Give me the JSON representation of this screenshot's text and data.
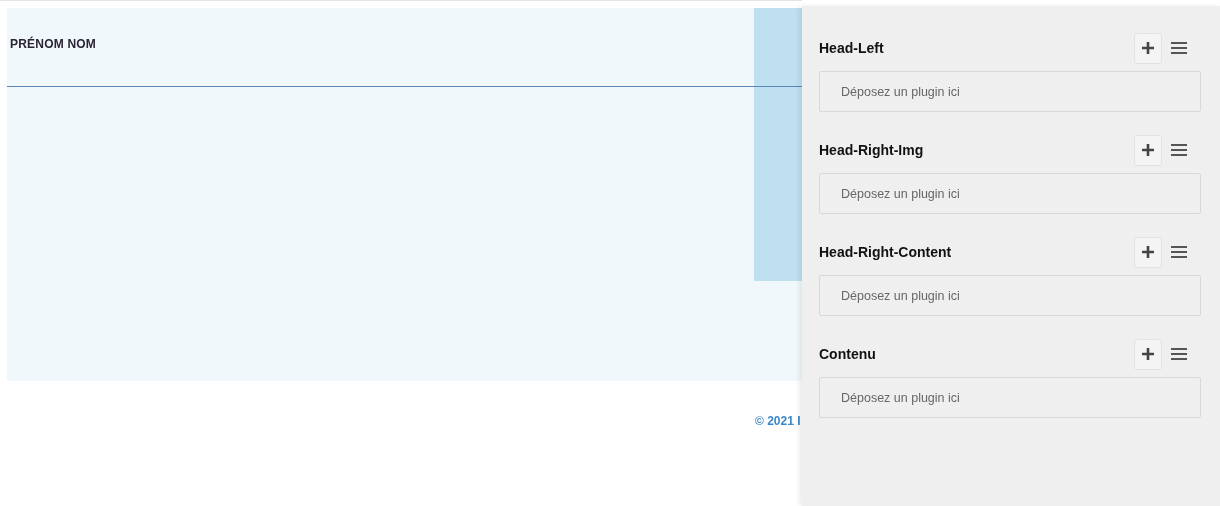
{
  "page": {
    "name": "PRÉNOM NOM",
    "footer": "© 2021 I"
  },
  "panel": {
    "sections": [
      {
        "title": "Head-Left",
        "drop_text": "Déposez un plugin ici"
      },
      {
        "title": "Head-Right-Img",
        "drop_text": "Déposez un plugin ici"
      },
      {
        "title": "Head-Right-Content",
        "drop_text": "Déposez un plugin ici"
      },
      {
        "title": "Contenu",
        "drop_text": "Déposez un plugin ici"
      }
    ]
  }
}
